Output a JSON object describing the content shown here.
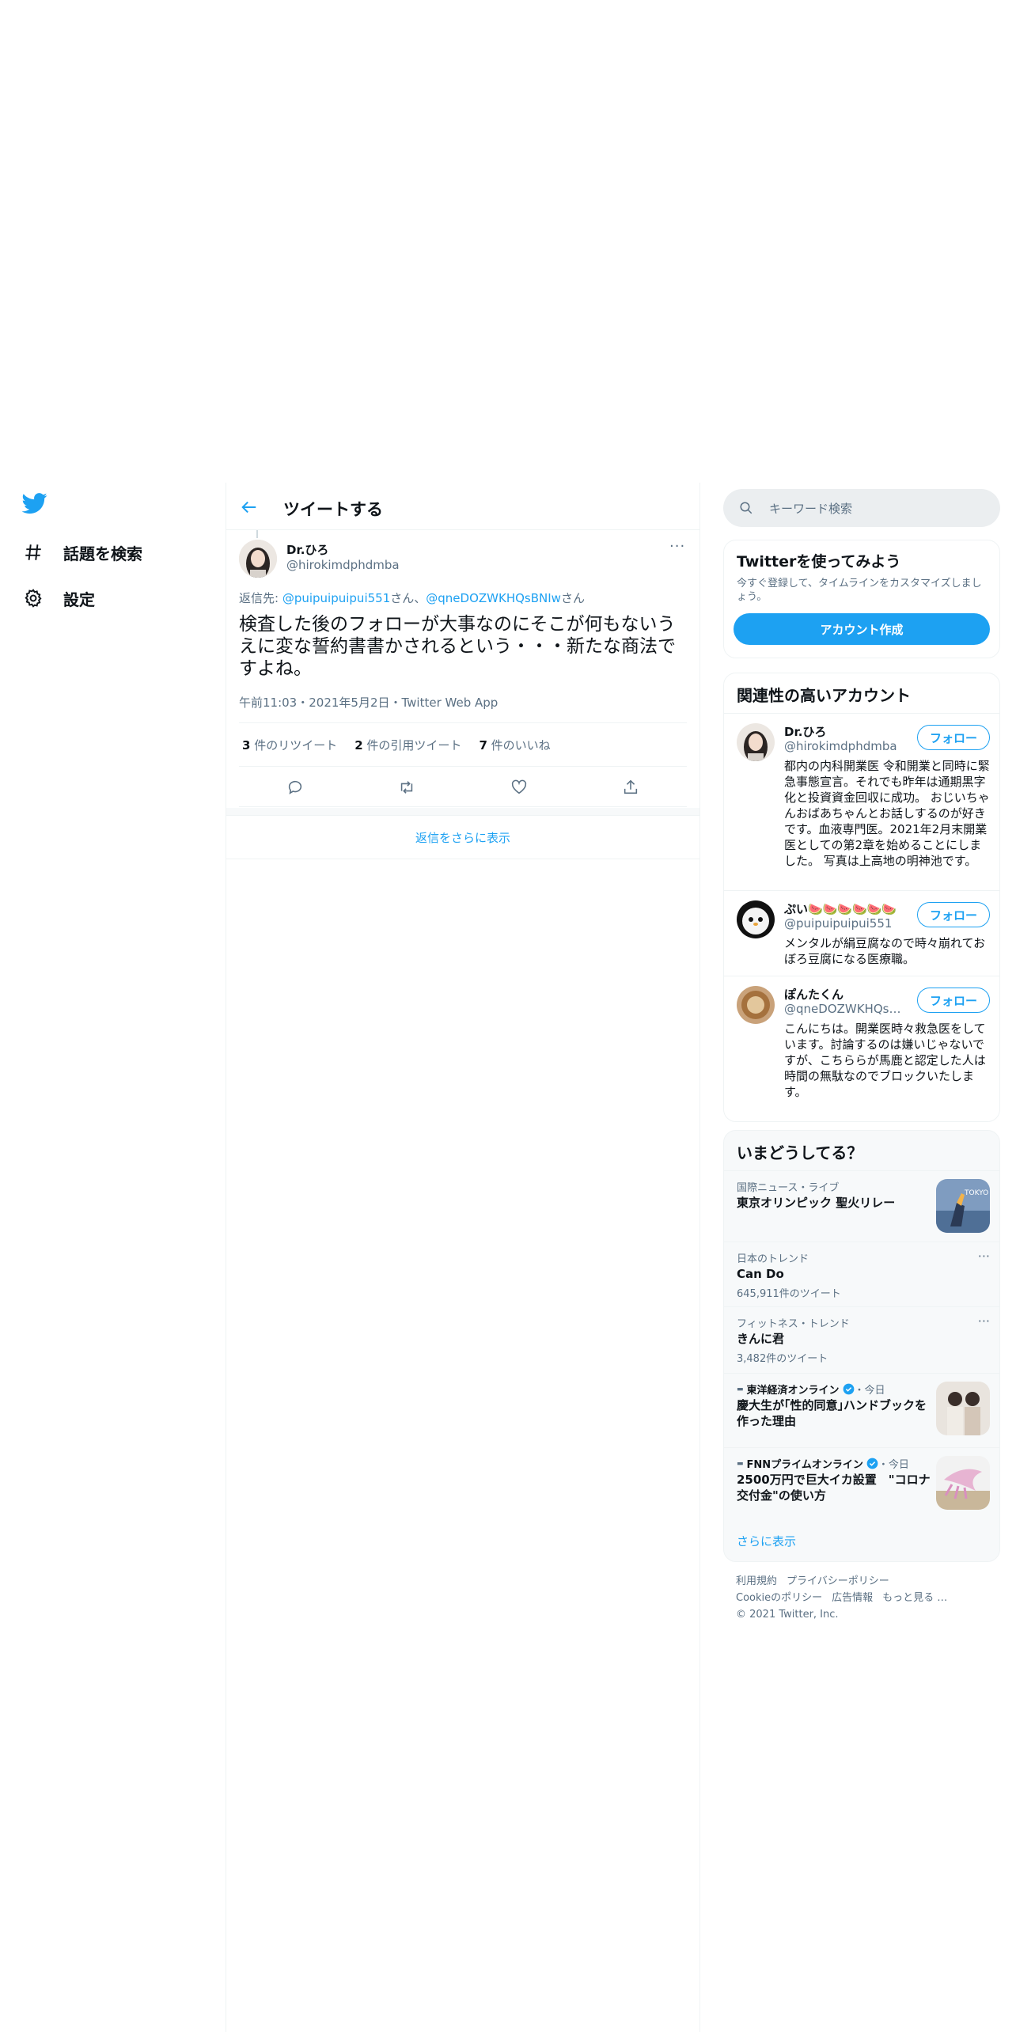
{
  "nav": {
    "items": [
      {
        "label": "話題を検索"
      },
      {
        "label": "設定"
      }
    ]
  },
  "header": {
    "title": "ツイートする"
  },
  "tweet": {
    "author_name": "Dr.ひろ",
    "author_handle": "@hirokimdphdmba",
    "reply_prefix": "返信先: ",
    "reply_user1": "@puipuipuipui551",
    "reply_mid": "さん、",
    "reply_user2": "@qneDOZWKHQsBNIw",
    "reply_suffix": "さん",
    "text": "検査した後のフォローが大事なのにそこが何もないうえに変な誓約書書かされるという・・・新たな商法ですよね。",
    "meta": "午前11:03・2021年5月2日・Twitter Web App",
    "retweets_count": "3",
    "retweets_label": " 件のリツイート",
    "quotes_count": "2",
    "quotes_label": " 件の引用ツイート",
    "likes_count": "7",
    "likes_label": " 件のいいね",
    "more_replies": "返信をさらに表示"
  },
  "search": {
    "placeholder": "キーワード検索"
  },
  "signup": {
    "title": "Twitterを使ってみよう",
    "subtitle": "今すぐ登録して、タイムラインをカスタマイズしましょう。",
    "button": "アカウント作成"
  },
  "related": {
    "title": "関連性の高いアカウント",
    "follow_label": "フォロー",
    "accounts": [
      {
        "name": "Dr.ひろ",
        "handle": "@hirokimdphdmba",
        "bio": "都内の内科開業医 令和開業と同時に緊急事態宣言。それでも昨年は通期黒字化と投資資金回収に成功。 おじいちゃんおばあちゃんとお話しするのが好きです。血液専門医。2021年2月末開業医としての第2章を始めることにしました。 写真は上高地の明神池です。"
      },
      {
        "name": "ぷい🍉🍉🍉🍉🍉🍉",
        "handle": "@puipuipuipui551",
        "bio": "メンタルが絹豆腐なので時々崩れておぼろ豆腐になる医療職。"
      },
      {
        "name": "ぽんたくん",
        "handle": "@qneDOZWKHQsBNIw",
        "bio": "こんにちは。開業医時々救急医をしています。討論するのは嫌いじゃないですが、こちららが馬鹿と認定した人は時間の無駄なのでブロックいたします。"
      }
    ]
  },
  "trends": {
    "title": "いまどうしてる？",
    "items": [
      {
        "category": "国際ニュース・ライブ",
        "name": "東京オリンピック 聖火リレー"
      },
      {
        "category": "日本のトレンド",
        "name": "Can Do",
        "count": "645,911件のツイート"
      },
      {
        "category": "フィットネス・トレンド",
        "name": "きんに君",
        "count": "3,482件のツイート"
      },
      {
        "source": "東洋経済オンライン",
        "time": "・今日",
        "name": "慶大生が｢性的同意｣ハンドブックを作った理由"
      },
      {
        "source": "FNNプライムオンライン",
        "time": "・今日",
        "name": "2500万円で巨大イカ設置　\"コロナ交付金\"の使い方"
      }
    ],
    "show_more": "さらに表示"
  },
  "footer": {
    "links": [
      "利用規約",
      "プライバシーポリシー",
      "Cookieのポリシー",
      "広告情報",
      "もっと見る …"
    ],
    "copyright": "© 2021 Twitter, Inc."
  },
  "colors": {
    "accent": "#1da1f2",
    "text": "#0f1419",
    "muted": "#5b7083"
  }
}
